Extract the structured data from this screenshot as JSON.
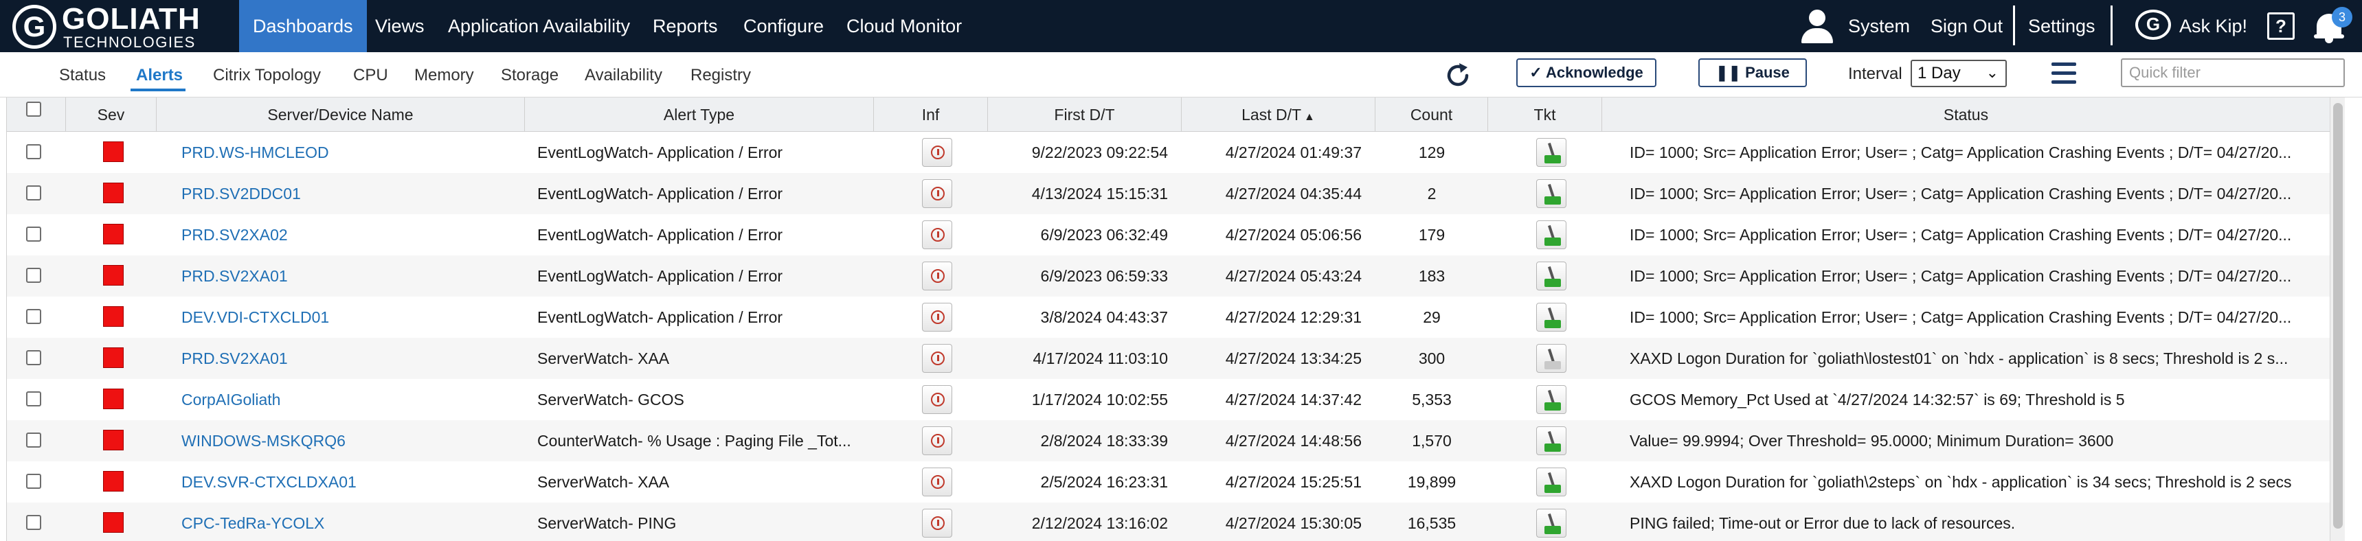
{
  "brand": {
    "name": "GOLIATH",
    "tagline": "TECHNOLOGIES",
    "registered": "®"
  },
  "nav": {
    "items": [
      {
        "label": "Dashboards",
        "active": true
      },
      {
        "label": "Views"
      },
      {
        "label": "Application Availability"
      },
      {
        "label": "Reports"
      },
      {
        "label": "Configure"
      },
      {
        "label": "Cloud Monitor"
      }
    ],
    "right": {
      "system": "System",
      "signout": "Sign Out",
      "settings": "Settings",
      "askkip": "Ask Kip!",
      "help": "?",
      "notifications": "3"
    }
  },
  "tabs": [
    {
      "label": "Status"
    },
    {
      "label": "Alerts",
      "active": true
    },
    {
      "label": "Citrix Topology"
    },
    {
      "label": "CPU"
    },
    {
      "label": "Memory"
    },
    {
      "label": "Storage"
    },
    {
      "label": "Availability"
    },
    {
      "label": "Registry"
    }
  ],
  "toolbar": {
    "acknowledge_label": "Acknowledge",
    "pause_label": "Pause",
    "interval_label": "Interval",
    "interval_value": "1 Day",
    "filter_placeholder": "Quick filter"
  },
  "columns": {
    "sev": "Sev",
    "server": "Server/Device Name",
    "alert_type": "Alert Type",
    "inf": "Inf",
    "first_dt": "First D/T",
    "last_dt": "Last D/T",
    "sort_indicator": "▲",
    "count": "Count",
    "tkt": "Tkt",
    "status": "Status"
  },
  "rows": [
    {
      "server": "PRD.WS-HMCLEOD",
      "alert_type": "EventLogWatch- Application / Error",
      "first_dt": "9/22/2023 09:22:54",
      "last_dt": "4/27/2024 01:49:37",
      "count": "129",
      "ticket": "green",
      "status": "ID= 1000; Src= Application Error; User= ; Catg= Application Crashing Events ; D/T= 04/27/20..."
    },
    {
      "server": "PRD.SV2DDC01",
      "alert_type": "EventLogWatch- Application / Error",
      "first_dt": "4/13/2024 15:15:31",
      "last_dt": "4/27/2024 04:35:44",
      "count": "2",
      "ticket": "green",
      "status": "ID= 1000; Src= Application Error; User= ; Catg= Application Crashing Events ; D/T= 04/27/20..."
    },
    {
      "server": "PRD.SV2XA02",
      "alert_type": "EventLogWatch- Application / Error",
      "first_dt": "6/9/2023 06:32:49",
      "last_dt": "4/27/2024 05:06:56",
      "count": "179",
      "ticket": "green",
      "status": "ID= 1000; Src= Application Error; User= ; Catg= Application Crashing Events ; D/T= 04/27/20..."
    },
    {
      "server": "PRD.SV2XA01",
      "alert_type": "EventLogWatch- Application / Error",
      "first_dt": "6/9/2023 06:59:33",
      "last_dt": "4/27/2024 05:43:24",
      "count": "183",
      "ticket": "green",
      "status": "ID= 1000; Src= Application Error; User= ; Catg= Application Crashing Events ; D/T= 04/27/20..."
    },
    {
      "server": "DEV.VDI-CTXCLD01",
      "alert_type": "EventLogWatch- Application / Error",
      "first_dt": "3/8/2024 04:43:37",
      "last_dt": "4/27/2024 12:29:31",
      "count": "29",
      "ticket": "green",
      "status": "ID= 1000; Src= Application Error; User= ; Catg= Application Crashing Events ; D/T= 04/27/20..."
    },
    {
      "server": "PRD.SV2XA01",
      "alert_type": "ServerWatch- XAA",
      "first_dt": "4/17/2024 11:03:10",
      "last_dt": "4/27/2024 13:34:25",
      "count": "300",
      "ticket": "grey",
      "status": "XAXD Logon Duration for `goliath\\lostest01` on `hdx - application` is 8 secs; Threshold is 2 s..."
    },
    {
      "server": "CorpAIGoliath",
      "alert_type": "ServerWatch- GCOS",
      "first_dt": "1/17/2024 10:02:55",
      "last_dt": "4/27/2024 14:37:42",
      "count": "5,353",
      "ticket": "green",
      "status": "GCOS Memory_Pct Used at `4/27/2024 14:32:57` is 69; Threshold is 5"
    },
    {
      "server": "WINDOWS-MSKQRQ6",
      "alert_type": "CounterWatch- % Usage : Paging File _Tot...",
      "first_dt": "2/8/2024 18:33:39",
      "last_dt": "4/27/2024 14:48:56",
      "count": "1,570",
      "ticket": "green",
      "status": "Value= 99.9994; Over Threshold= 95.0000; Minimum Duration= 3600"
    },
    {
      "server": "DEV.SVR-CTXCLDXA01",
      "alert_type": "ServerWatch- XAA",
      "first_dt": "2/5/2024 16:23:31",
      "last_dt": "4/27/2024 15:25:51",
      "count": "19,899",
      "ticket": "green",
      "status": "XAXD Logon Duration for `goliath\\2steps` on `hdx - application` is 34 secs; Threshold is 2 secs"
    },
    {
      "server": "CPC-TedRa-YCOLX",
      "alert_type": "ServerWatch- PING",
      "first_dt": "2/12/2024 13:16:02",
      "last_dt": "4/27/2024 15:30:05",
      "count": "16,535",
      "ticket": "green",
      "status": "PING failed; Time-out or Error due to lack of resources."
    }
  ],
  "colors": {
    "topbar": "#0c1a2c",
    "active_nav": "#3276c8",
    "link": "#1f6fb5",
    "severity_critical": "#ee1111",
    "ticket_open": "#2fa52f"
  }
}
